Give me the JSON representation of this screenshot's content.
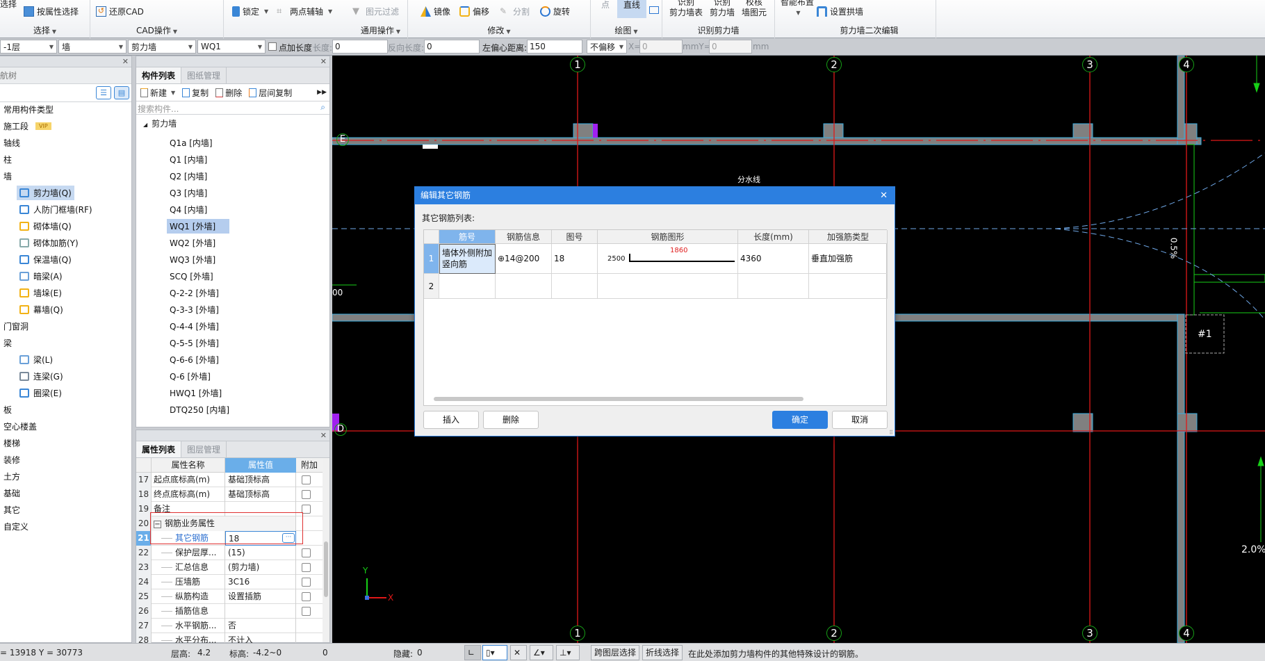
{
  "ribbon": {
    "groups": [
      {
        "label": "选择",
        "items": [
          {
            "label": "选择"
          },
          {
            "label": "按属性选择"
          }
        ]
      },
      {
        "label": "CAD操作",
        "items": [
          {
            "label": "还原CAD"
          }
        ]
      },
      {
        "label": "通用操作",
        "items": [
          {
            "label": "锁定"
          },
          {
            "label": "两点辅轴"
          },
          {
            "label": "图元过滤"
          }
        ]
      },
      {
        "label": "修改",
        "items": [
          {
            "label": "镜像"
          },
          {
            "label": "偏移"
          },
          {
            "label": "分割"
          },
          {
            "label": "旋转"
          }
        ]
      },
      {
        "label": "绘图",
        "items": [
          {
            "label": "点"
          },
          {
            "label": "直线"
          }
        ]
      },
      {
        "label": "识别剪力墙",
        "items": [
          {
            "label": "识别",
            "label2": "剪力墙表"
          },
          {
            "label": "识别",
            "label2": "剪力墙"
          },
          {
            "label": "校核",
            "label2": "墙图元"
          }
        ]
      },
      {
        "label": "剪力墙二次编辑",
        "items": [
          {
            "label": "智能布置"
          },
          {
            "label": "设置拱墙"
          }
        ]
      }
    ]
  },
  "toolbar2": {
    "floor": "-1层",
    "category": "墙",
    "type": "剪力墙",
    "component": "WQ1",
    "add_length_label": "点加长度",
    "length_label": "长度:",
    "length_value": "0",
    "reverse_length_label": "反向长度:",
    "reverse_length_value": "0",
    "left_offset_label": "左偏心距离:",
    "left_offset_value": "150",
    "offset_mode": "不偏移",
    "x_label": "X=",
    "x_value": "0",
    "mm_y_label": "mmY=",
    "y_value": "0",
    "mm_label": "mm"
  },
  "nav": {
    "title": "导航树",
    "items": [
      {
        "label": "常用构件类型"
      },
      {
        "label": "施工段",
        "badge": "VIP"
      },
      {
        "label": "轴线"
      },
      {
        "label": "柱"
      },
      {
        "label": "墙"
      },
      {
        "label": "剪力墙(Q)",
        "sub": true,
        "selected": true
      },
      {
        "label": "人防门框墙(RF)",
        "sub": true
      },
      {
        "label": "砌体墙(Q)",
        "sub": true
      },
      {
        "label": "砌体加筋(Y)",
        "sub": true
      },
      {
        "label": "保温墙(Q)",
        "sub": true
      },
      {
        "label": "暗梁(A)",
        "sub": true
      },
      {
        "label": "墙垛(E)",
        "sub": true
      },
      {
        "label": "幕墙(Q)",
        "sub": true
      },
      {
        "label": "门窗洞"
      },
      {
        "label": "梁"
      },
      {
        "label": "梁(L)",
        "sub": true
      },
      {
        "label": "连梁(G)",
        "sub": true
      },
      {
        "label": "圈梁(E)",
        "sub": true
      },
      {
        "label": "板"
      },
      {
        "label": "空心楼盖"
      },
      {
        "label": "楼梯"
      },
      {
        "label": "装修"
      },
      {
        "label": "土方"
      },
      {
        "label": "基础"
      },
      {
        "label": "其它"
      },
      {
        "label": "自定义"
      }
    ]
  },
  "component_panel": {
    "tabs": [
      "构件列表",
      "图纸管理"
    ],
    "toolbar": {
      "new": "新建",
      "copy": "复制",
      "delete": "删除",
      "floor_copy": "层间复制"
    },
    "search_placeholder": "搜索构件...",
    "group": "剪力墙",
    "items": [
      "Q1a [内墙]",
      "Q1 [内墙]",
      "Q2 [内墙]",
      "Q3 [内墙]",
      "Q4 [内墙]",
      "WQ1 [外墙]",
      "WQ2 [外墙]",
      "WQ3 [外墙]",
      "SCQ [外墙]",
      "Q-2-2 [外墙]",
      "Q-3-3 [外墙]",
      "Q-4-4 [外墙]",
      "Q-5-5 [外墙]",
      "Q-6-6 [外墙]",
      "Q-6 [外墙]",
      "HWQ1 [外墙]",
      "DTQ250 [内墙]"
    ],
    "selected_index": 5
  },
  "property_panel": {
    "tabs": [
      "属性列表",
      "图层管理"
    ],
    "headers": {
      "name": "属性名称",
      "value": "属性值",
      "extra": "附加"
    },
    "rows": [
      {
        "num": "17",
        "name": "起点底标高(m)",
        "value": "基础顶标高",
        "check": true
      },
      {
        "num": "18",
        "name": "终点底标高(m)",
        "value": "基础顶标高",
        "check": true
      },
      {
        "num": "19",
        "name": "备注",
        "value": "",
        "check": true
      },
      {
        "num": "20",
        "name": "钢筋业务属性",
        "value": "",
        "group": true
      },
      {
        "num": "21",
        "name": "其它钢筋",
        "value": "18",
        "sub": true,
        "active": true
      },
      {
        "num": "22",
        "name": "保护层厚...",
        "value": "(15)",
        "sub": true,
        "check": true
      },
      {
        "num": "23",
        "name": "汇总信息",
        "value": "(剪力墙)",
        "sub": true,
        "check": true
      },
      {
        "num": "24",
        "name": "压墙筋",
        "value": "3C16",
        "sub": true,
        "check": true
      },
      {
        "num": "25",
        "name": "纵筋构造",
        "value": "设置插筋",
        "sub": true,
        "check": true
      },
      {
        "num": "26",
        "name": "插筋信息",
        "value": "",
        "sub": true,
        "check": true
      },
      {
        "num": "27",
        "name": "水平钢筋...",
        "value": "否",
        "sub": true
      },
      {
        "num": "28",
        "name": "水平分布...",
        "value": "不计入",
        "sub": true
      }
    ]
  },
  "canvas": {
    "axis_labels_top": [
      "1",
      "2",
      "3",
      "4"
    ],
    "axis_labels_bottom": [
      "1",
      "2",
      "3",
      "4"
    ],
    "row_labels": [
      "E",
      "D"
    ],
    "annotations": [
      "分水线",
      "0.5%",
      "2.0%",
      "#1",
      "00"
    ],
    "ucs": {
      "x": "X",
      "y": "Y"
    }
  },
  "dialog": {
    "title": "编辑其它钢筋",
    "list_label": "其它钢筋列表:",
    "columns": [
      "筋号",
      "钢筋信息",
      "图号",
      "钢筋图形",
      "长度(mm)",
      "加强筋类型"
    ],
    "rows": [
      {
        "index": "1",
        "name": "墙体外侧附加竖向筋",
        "info": "⊕14@200",
        "shape_no": "18",
        "shape_left": "2500",
        "shape_top": "1860",
        "length": "4360",
        "type": "垂直加强筋"
      },
      {
        "index": "2",
        "name": "",
        "info": "",
        "shape_no": "",
        "shape_left": "",
        "shape_top": "",
        "length": "",
        "type": ""
      }
    ],
    "buttons": {
      "insert": "插入",
      "delete": "删除",
      "ok": "确定",
      "cancel": "取消"
    },
    "accent": "#2c7fe0"
  },
  "statusbar": {
    "coords": "= 13918 Y = 30773",
    "floor_height_label": "层高:",
    "floor_height": "4.2",
    "elevation_label": "标高:",
    "elevation": "-4.2~0",
    "count": "0",
    "hidden_label": "隐藏:",
    "hidden": "0",
    "cross_layer": "跨图层选择",
    "polyline": "折线选择",
    "hint": "在此处添加剪力墙构件的其他特殊设计的钢筋。"
  }
}
